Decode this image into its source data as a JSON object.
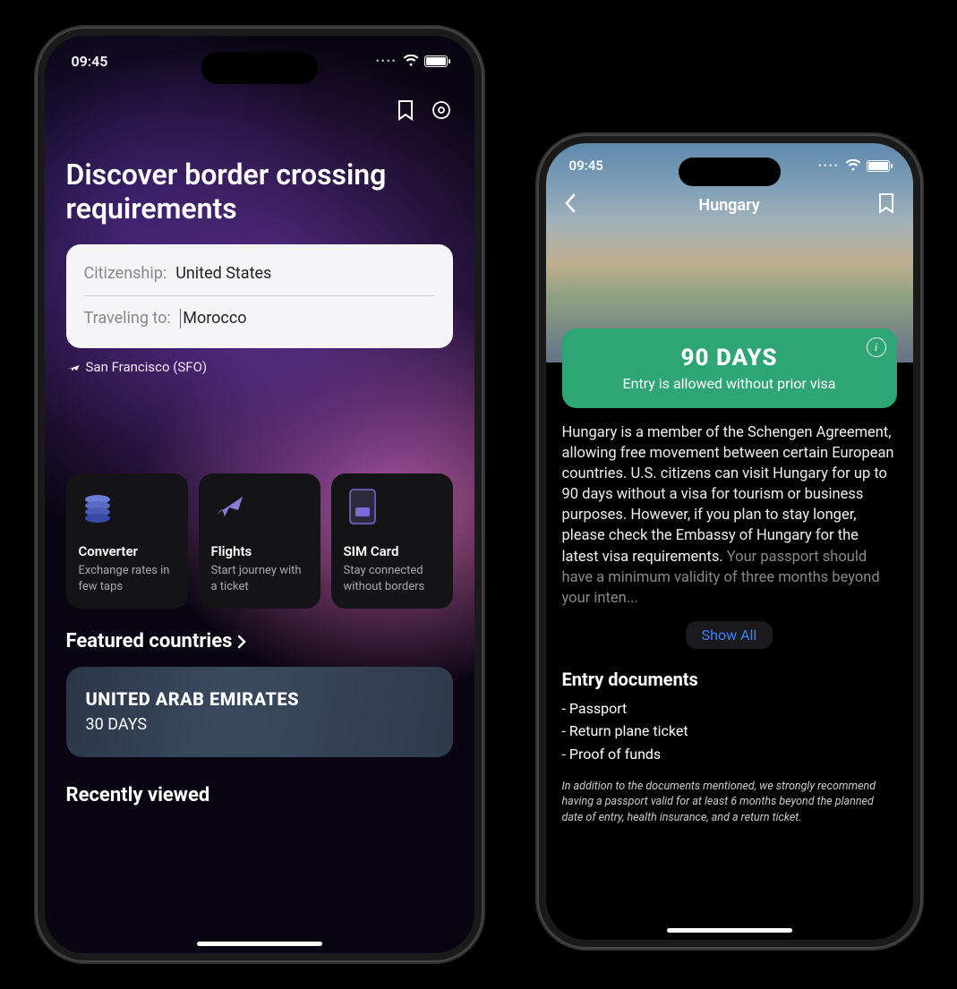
{
  "status": {
    "time": "09:45"
  },
  "screen1": {
    "title": "Discover border crossing requirements",
    "search": {
      "citizenship_label": "Citizenship:",
      "citizenship_value": "United States",
      "traveling_label": "Traveling to:",
      "traveling_value": "Morocco"
    },
    "departure": "San Francisco (SFO)",
    "tools": [
      {
        "icon": "coins",
        "title": "Converter",
        "desc": "Exchange rates in few taps"
      },
      {
        "icon": "plane",
        "title": "Flights",
        "desc": "Start journey with a ticket"
      },
      {
        "icon": "sim",
        "title": "SIM Card",
        "desc": "Stay connected without borders"
      }
    ],
    "featured_header": "Featured countries",
    "featured": {
      "name": "UNITED ARAB EMIRATES",
      "days": "30 DAYS"
    },
    "recent_header": "Recently viewed"
  },
  "screen2": {
    "page_title": "Hungary",
    "status_card": {
      "days": "90 DAYS",
      "msg": "Entry is allowed without prior visa"
    },
    "description": "Hungary is a member of the Schengen Agreement, allowing free movement between certain European countries. U.S. citizens can visit Hungary for up to 90 days without a visa for tourism or business purposes. However, if you plan to stay longer, please check the Embassy of Hungary for the latest visa requirements.",
    "description_fade": "Your passport should have a minimum validity of three months beyond your inten...",
    "show_all": "Show All",
    "docs_header": "Entry documents",
    "docs": [
      "Passport",
      "Return plane ticket",
      "Proof of funds"
    ],
    "docs_note": "In addition to the documents mentioned, we strongly recommend having a passport valid for at least 6 months beyond the planned date of entry, health insurance, and a return ticket."
  }
}
